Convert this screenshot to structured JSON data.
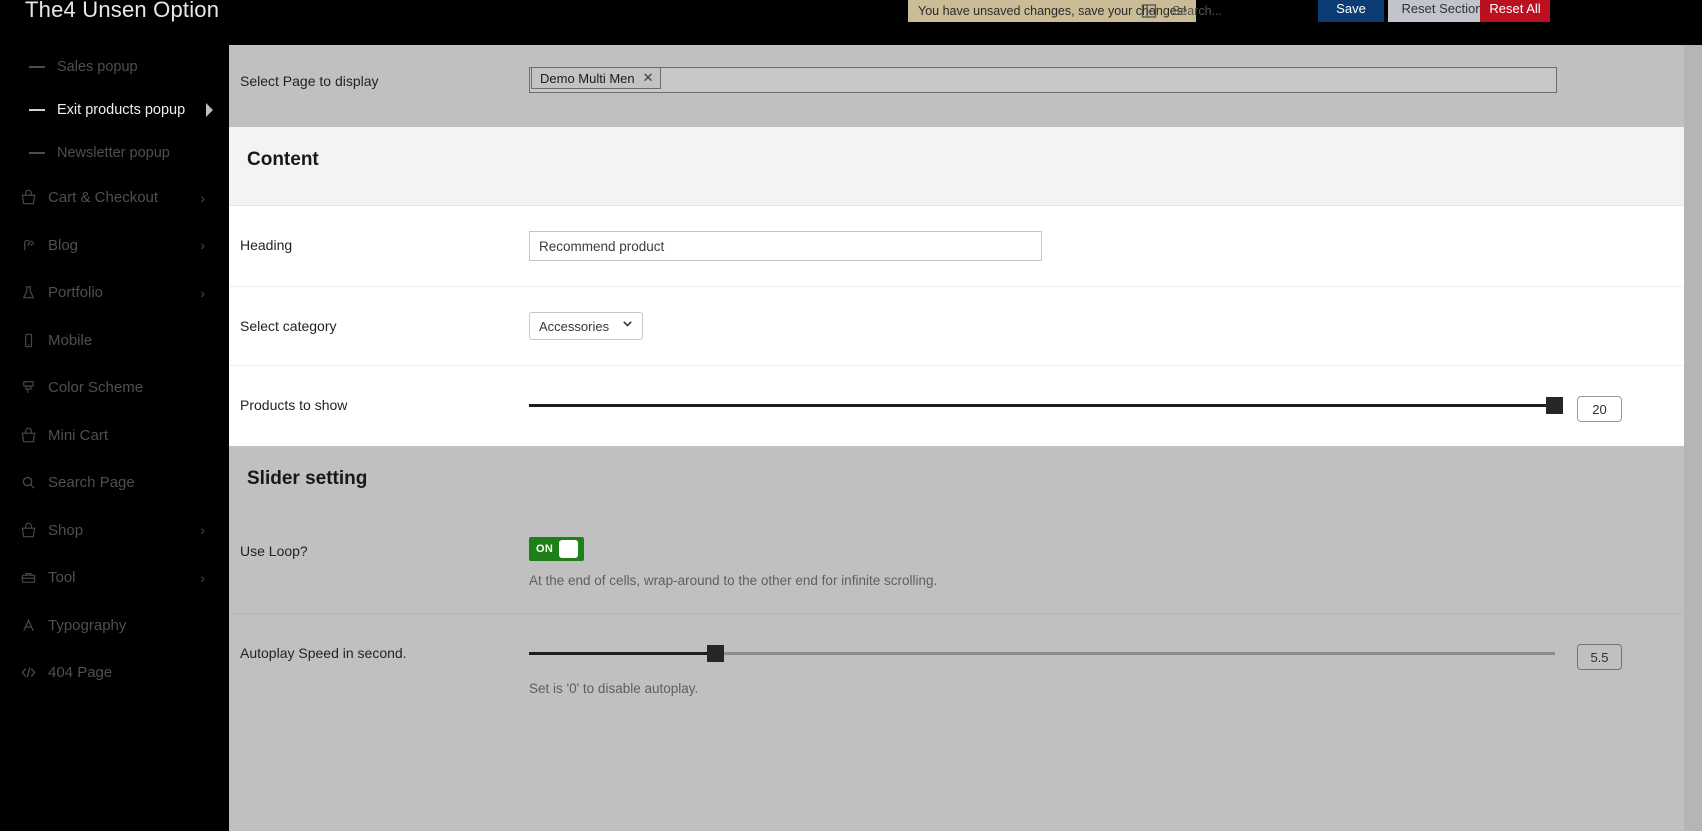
{
  "header": {
    "brand": "The4 Unsen Option",
    "unsaved_notice": "You have unsaved changes, save your changes!",
    "collapse_icon": "collapse-menu-icon",
    "search_placeholder": "Search...",
    "search_value": "",
    "save_label": "Save",
    "reset_section_label": "Reset Section",
    "reset_all_label": "Reset All",
    "colors": {
      "save_bg": "#0b3c74",
      "reset_section_bg": "#c1c5cb",
      "reset_all_bg": "#bb1020",
      "notice_bg": "#c9bc96"
    }
  },
  "sidebar": {
    "sub_items": [
      {
        "label": "Sales popup",
        "active": false
      },
      {
        "label": "Exit products popup",
        "active": true
      },
      {
        "label": "Newsletter popup",
        "active": false
      }
    ],
    "items": [
      {
        "label": "Cart & Checkout",
        "icon": "cart-icon",
        "chevron": "›"
      },
      {
        "label": "Blog",
        "icon": "blog-icon",
        "chevron": "›"
      },
      {
        "label": "Portfolio",
        "icon": "flask-icon",
        "chevron": "›"
      },
      {
        "label": "Mobile",
        "icon": "mobile-icon",
        "chevron": ""
      },
      {
        "label": "Color Scheme",
        "icon": "brush-icon",
        "chevron": ""
      },
      {
        "label": "Mini Cart",
        "icon": "cart-icon",
        "chevron": ""
      },
      {
        "label": "Search Page",
        "icon": "search-icon",
        "chevron": ""
      },
      {
        "label": "Shop",
        "icon": "cart-icon",
        "chevron": "›"
      },
      {
        "label": "Tool",
        "icon": "toolbox-icon",
        "chevron": "›"
      },
      {
        "label": "Typography",
        "icon": "typography-icon",
        "chevron": ""
      },
      {
        "label": "404 Page",
        "icon": "code-icon",
        "chevron": ""
      }
    ]
  },
  "main": {
    "select_page": {
      "label": "Select Page to display",
      "tag_label": "Demo Multi Men",
      "remove_icon": "✕"
    },
    "content_section": {
      "title": "Content",
      "heading": {
        "label": "Heading",
        "value": "Recommend product",
        "placeholder": ""
      },
      "category": {
        "label": "Select category",
        "selected": "Accessories",
        "options": [
          "Accessories"
        ],
        "caret_icon": "chevron-down-icon"
      },
      "products_to_show": {
        "label": "Products to show",
        "value": "20",
        "percent": 100
      }
    },
    "slider_section": {
      "title": "Slider setting",
      "use_loop": {
        "label": "Use Loop?",
        "state": "ON",
        "helper": "At the end of cells, wrap-around to the other end for infinite scrolling."
      },
      "autoplay_speed": {
        "label": "Autoplay Speed in second.",
        "value": "5.5",
        "percent": 18.2,
        "helper": "Set is '0' to disable autoplay."
      }
    }
  }
}
